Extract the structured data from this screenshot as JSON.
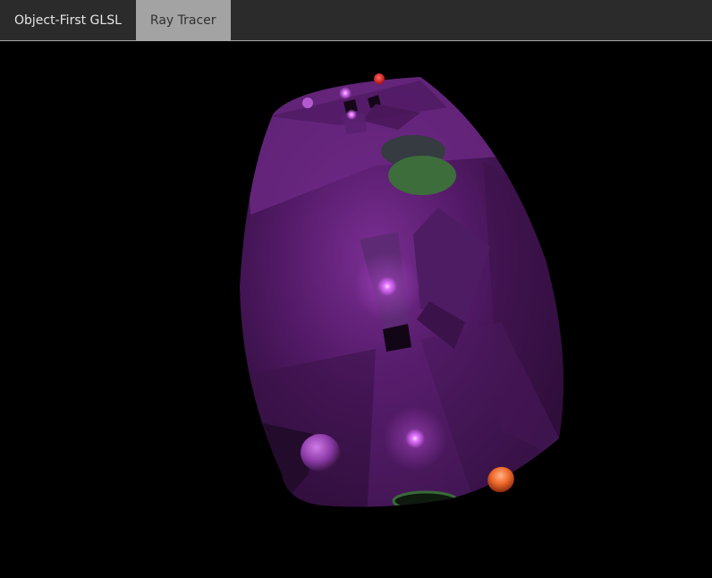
{
  "tabs": [
    {
      "label": "Object-First GLSL",
      "active": false
    },
    {
      "label": "Ray Tracer",
      "active": true
    }
  ],
  "render": {
    "background": "#000000",
    "accent_purple": "#8a2ba8",
    "light_color": "#e68cff",
    "green_patch": "#3d6a3a",
    "orange_sphere": "#f06a2a",
    "red_sphere": "#e01818"
  }
}
